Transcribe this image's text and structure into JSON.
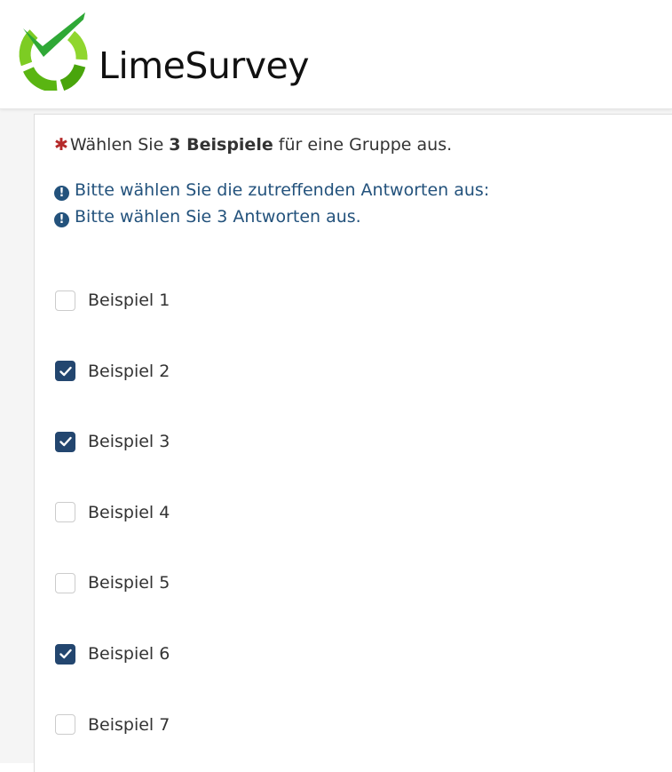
{
  "brand": {
    "name": "LimeSurvey"
  },
  "question": {
    "required_marker": "✱",
    "text_before": "Wählen Sie ",
    "text_bold": "3 Beispiele",
    "text_after": " für eine Gruppe aus."
  },
  "tips": [
    {
      "icon": "exclamation-circle-icon",
      "text": "Bitte wählen Sie die zutreffenden Antworten aus:"
    },
    {
      "icon": "exclamation-circle-icon",
      "text": "Bitte wählen Sie 3 Antworten aus."
    }
  ],
  "options": [
    {
      "label": "Beispiel 1",
      "checked": false
    },
    {
      "label": "Beispiel 2",
      "checked": true
    },
    {
      "label": "Beispiel 3",
      "checked": true
    },
    {
      "label": "Beispiel 4",
      "checked": false
    },
    {
      "label": "Beispiel 5",
      "checked": false
    },
    {
      "label": "Beispiel 6",
      "checked": true
    },
    {
      "label": "Beispiel 7",
      "checked": false
    }
  ],
  "colors": {
    "brand_green": "#6cbf1e",
    "tip_blue": "#23527c",
    "checkbox_checked": "#23466f",
    "required_red": "#b52a2a"
  }
}
